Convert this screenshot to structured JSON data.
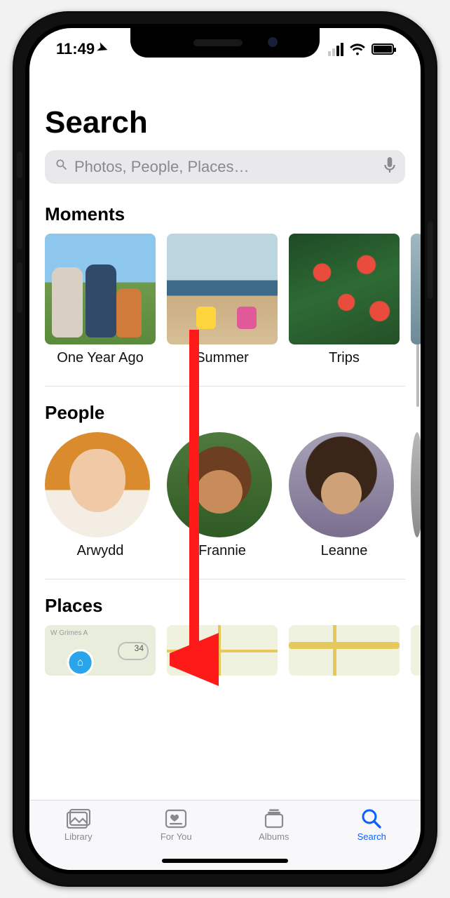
{
  "status": {
    "time": "11:49",
    "location_services": true,
    "signal_bars_active": 2,
    "wifi_bars": 3,
    "battery_pct": 95
  },
  "header": {
    "title": "Search"
  },
  "search": {
    "placeholder": "Photos, People, Places…",
    "value": ""
  },
  "sections": {
    "moments": {
      "heading": "Moments",
      "items": [
        {
          "label": "One Year Ago"
        },
        {
          "label": "Summer"
        },
        {
          "label": "Trips"
        }
      ]
    },
    "people": {
      "heading": "People",
      "items": [
        {
          "label": "Arwydd"
        },
        {
          "label": "Frannie"
        },
        {
          "label": "Leanne"
        }
      ]
    },
    "places": {
      "heading": "Places",
      "map_labels": {
        "street": "W Grimes A",
        "route": "34"
      }
    }
  },
  "tabbar": {
    "items": [
      {
        "label": "Library",
        "icon": "photo-stack-icon",
        "active": false
      },
      {
        "label": "For You",
        "icon": "heart-card-icon",
        "active": false
      },
      {
        "label": "Albums",
        "icon": "album-stack-icon",
        "active": false
      },
      {
        "label": "Search",
        "icon": "magnifier-icon",
        "active": true
      }
    ]
  },
  "colors": {
    "accent": "#0a5fff",
    "searchbar_bg": "#e9e9eb",
    "placeholder": "#8a8a8e"
  }
}
